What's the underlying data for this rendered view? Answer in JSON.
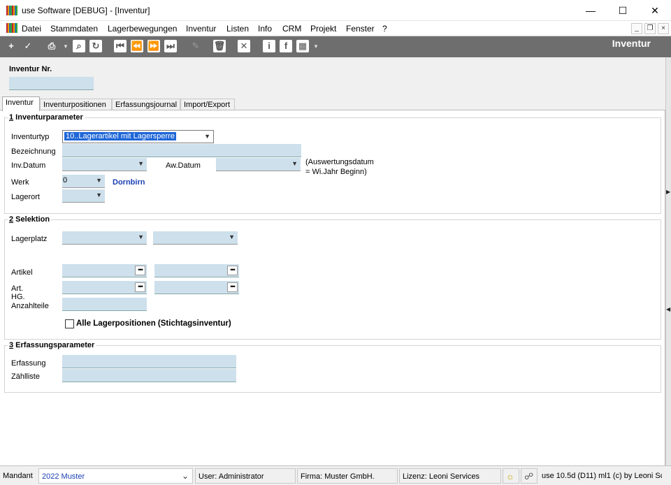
{
  "window": {
    "title": "use Software [DEBUG] - [Inventur]"
  },
  "menu": [
    "Datei",
    "Stammdaten",
    "Lagerbewegungen",
    "Inventur",
    "Listen",
    "Info",
    "CRM",
    "Projekt",
    "Fenster",
    "?"
  ],
  "toolbar": {
    "title": "Inventur",
    "icons": [
      "plus-icon",
      "check-icon",
      "print-icon",
      "search-icon",
      "refresh-icon",
      "first-record-icon",
      "previous-record-icon",
      "next-record-icon",
      "last-record-icon",
      "edit-icon",
      "delete-icon",
      "close-icon",
      "info-icon",
      "facebook-icon",
      "grid-icon"
    ]
  },
  "header": {
    "label": "Inventur Nr.",
    "value": ""
  },
  "tabs": [
    "Inventur",
    "Inventurpositionen",
    "Erfassungsjournal",
    "Import/Export"
  ],
  "section1": {
    "number": "1",
    "title": " Inventurparameter",
    "inventurtyp_label": "Inventurtyp",
    "inventurtyp_value": "10..Lagerartikel mit Lagersperre",
    "bezeichnung_label": "Bezeichnung",
    "inv_datum_label": "Inv.Datum",
    "aw_datum_label": "Aw.Datum",
    "note_line1": "(Auswertungsdatum",
    "note_line2": "= Wi.Jahr Beginn)",
    "werk_label": "Werk",
    "werk_value": "0",
    "werk_name": "Dornbirn",
    "lagerort_label": "Lagerort"
  },
  "section2": {
    "number": "2",
    "title": " Selektion",
    "lagerplatz_label": "Lagerplatz",
    "artikel_label": "Artikel",
    "art_hg_label_1": "Art.",
    "art_hg_label_2": "HG.",
    "anzahlteile_label": "Anzahlteile",
    "checkbox_label": "Alle Lagerpositionen (Stichtagsinventur)"
  },
  "section3": {
    "number": "3",
    "title": " Erfassungsparameter",
    "erfassung_label": "Erfassung",
    "zaehlliste_label": "Zählliste"
  },
  "status": {
    "mandant_label": "Mandant",
    "mandant_value": "2022 Muster",
    "user": "User: Administrator",
    "firma": "Firma: Muster GmbH.",
    "lizenz": "Lizenz: Leoni Services",
    "version": "use 10.5d (D11) ml1 (c) by Leoni Sc"
  }
}
